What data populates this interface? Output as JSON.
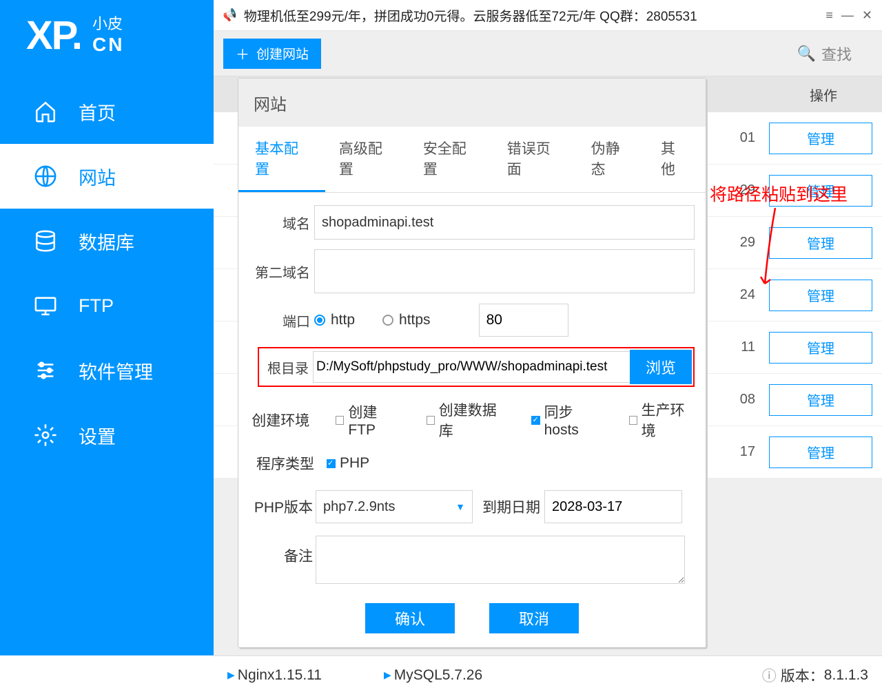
{
  "logo": {
    "xp": "XP.",
    "small": "小皮",
    "cn": "CN"
  },
  "sidebar": {
    "items": [
      {
        "label": "首页"
      },
      {
        "label": "网站"
      },
      {
        "label": "数据库"
      },
      {
        "label": "FTP"
      },
      {
        "label": "软件管理"
      },
      {
        "label": "设置"
      }
    ]
  },
  "topbar": {
    "announcement": "物理机低至299元/年，拼团成功0元得。云服务器低至72元/年  QQ群：2805531"
  },
  "toolbar": {
    "create_label": "创建网站",
    "search_label": "查找"
  },
  "table": {
    "op_header": "操作",
    "manage_label": "管理",
    "rows": [
      {
        "date_suffix": "01"
      },
      {
        "date_suffix": "29"
      },
      {
        "date_suffix": "29"
      },
      {
        "date_suffix": "24"
      },
      {
        "date_suffix": "11"
      },
      {
        "date_suffix": "08"
      },
      {
        "date_suffix": "17"
      }
    ]
  },
  "dialog": {
    "title": "网站",
    "tabs": [
      "基本配置",
      "高级配置",
      "安全配置",
      "错误页面",
      "伪静态",
      "其他"
    ],
    "form": {
      "domain_label": "域名",
      "domain_value": "shopadminapi.test",
      "second_domain_label": "第二域名",
      "second_domain_value": "",
      "port_label": "端口",
      "http_label": "http",
      "https_label": "https",
      "port_value": "80",
      "root_label": "根目录",
      "root_value": "D:/MySoft/phpstudy_pro/WWW/shopadminapi.test",
      "browse_label": "浏览",
      "env_label": "创建环境",
      "create_ftp_label": "创建FTP",
      "create_db_label": "创建数据库",
      "sync_hosts_label": "同步hosts",
      "prod_env_label": "生产环境",
      "type_label": "程序类型",
      "php_label": "PHP",
      "php_version_label": "PHP版本",
      "php_version_value": "php7.2.9nts",
      "expiry_label": "到期日期",
      "expiry_value": "2028-03-17",
      "remark_label": "备注"
    },
    "confirm": "确认",
    "cancel": "取消"
  },
  "annotation": {
    "text": "将路径粘贴到这里"
  },
  "statusbar": {
    "nginx": "Nginx1.15.11",
    "mysql": "MySQL5.7.26",
    "version_label": "版本：",
    "version_value": "8.1.1.3"
  }
}
